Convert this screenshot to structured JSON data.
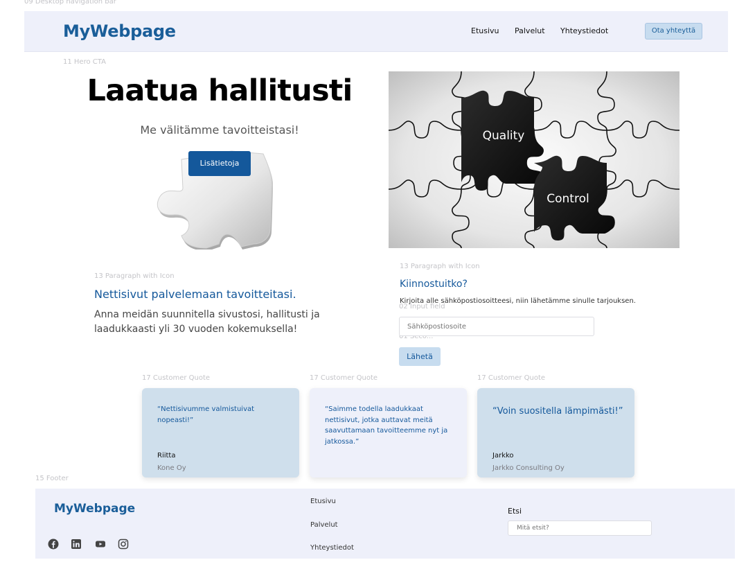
{
  "labels": {
    "nav": "09 Desktop navigation bar",
    "hero": "11 Hero CTA",
    "para1": "13 Paragraph with Icon",
    "para2": "13 Paragraph with Icon",
    "input": "02 Input field",
    "secondary": "01 Seco...",
    "quote1": "17 Customer Quote",
    "quote2": "17 Customer Quote",
    "quote3": "17 Customer Quote",
    "footer": "15 Footer"
  },
  "header": {
    "brand": "MyWebpage",
    "nav_items": [
      "Etusivu",
      "Palvelut",
      "Yhteystiedot"
    ],
    "cta": "Ota yhteyttä"
  },
  "hero": {
    "title": "Laatua hallitusti",
    "subtitle": "Me välitämme tavoitteistasi!",
    "button": "Lisätietoja",
    "puzzle_words": [
      "Quality",
      "Control"
    ]
  },
  "intro": {
    "heading": "Nettisivut palvelemaan tavoitteitasi.",
    "body": "Anna meidän suunnitella sivustosi, hallitusti ja laadukkaasti yli 30 vuoden kokemuksella!"
  },
  "contact": {
    "heading": "Kiinnostuitko?",
    "body": "Kirjoita alle sähköpostiosoitteesi, niin lähetämme sinulle tarjouksen.",
    "placeholder": "Sähköpostiosoite",
    "button": "Lähetä"
  },
  "quotes": [
    {
      "text": "“Nettisivumme valmistuivat nopeasti!”",
      "name": "Riitta",
      "company": "Kone Oy"
    },
    {
      "text": "“Saimme todella laadukkaat nettisivut, jotka auttavat meitä saavuttamaan tavoitteemme nyt ja jatkossa.”",
      "name": "",
      "company": ""
    },
    {
      "text": "“Voin suositella lämpimästi!”",
      "name": "Jarkko",
      "company": "Jarkko Consulting Oy"
    }
  ],
  "footer": {
    "brand": "MyWebpage",
    "links": [
      "Etusivu",
      "Palvelut",
      "Yhteystiedot"
    ],
    "search_label": "Etsi",
    "search_placeholder": "Mitä etsit?",
    "social_icons": [
      "facebook-icon",
      "linkedin-icon",
      "youtube-icon",
      "instagram-icon"
    ]
  },
  "colors": {
    "brand": "#1a5e99",
    "primary_button": "#14589b",
    "light_blue": "#cfdfec",
    "lavender": "#eef0fa"
  }
}
